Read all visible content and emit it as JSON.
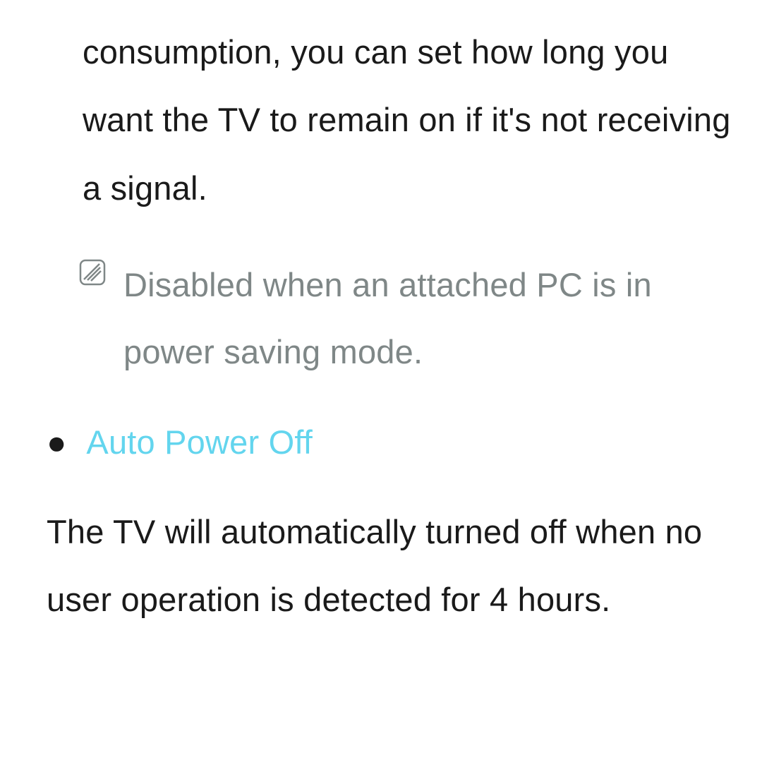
{
  "section1": {
    "paragraph": "consumption, you can set how long you want the TV to remain on if it's not receiving a signal."
  },
  "note": {
    "text": "Disabled when an attached PC is in power saving mode."
  },
  "section2": {
    "heading": "Auto Power Off",
    "body": "The TV will automatically turned off when no user operation is detected for 4 hours."
  }
}
